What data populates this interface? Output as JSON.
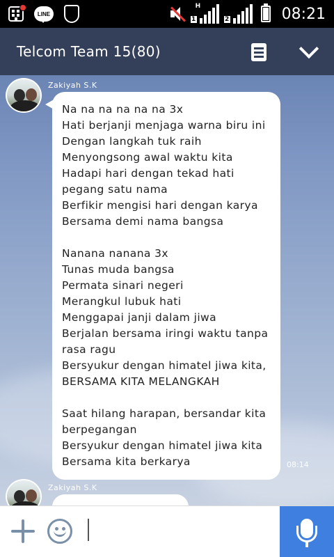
{
  "status_bar": {
    "time": "08:21",
    "line_app_label": "LINE",
    "signal_1_tag": "1",
    "signal_2_tag": "2",
    "network_type": "H"
  },
  "header": {
    "title": "Telcom Team 15(80)"
  },
  "messages": [
    {
      "sender": "Zakiyah S.K",
      "time": "08:14",
      "lines": [
        "Na na na na na na 3x",
        "Hati berjanji menjaga warna biru ini",
        "Dengan langkah tuk raih",
        "Menyongsong awal waktu kita",
        "Hadapi hari dengan tekad hati",
        "pegang satu nama",
        "Berfikir mengisi hari dengan karya",
        "Bersama demi nama bangsa",
        "",
        "Nanana nanana 3x",
        "Tunas muda bangsa",
        "Permata sinari negeri",
        "Merangkul lubuk hati",
        "Menggapai janji dalam jiwa",
        "Berjalan bersama iringi waktu tanpa",
        "rasa ragu",
        "Bersyukur dengan himatel jiwa kita,",
        "BERSAMA KITA MELANGKAH",
        "",
        "Saat hilang harapan, bersandar kita",
        "berpegangan",
        "Bersyukur dengan himatel jiwa kita",
        "Bersama kita berkarya"
      ]
    },
    {
      "sender": "Zakiyah S.K"
    }
  ],
  "input": {
    "value": "",
    "placeholder": ""
  }
}
